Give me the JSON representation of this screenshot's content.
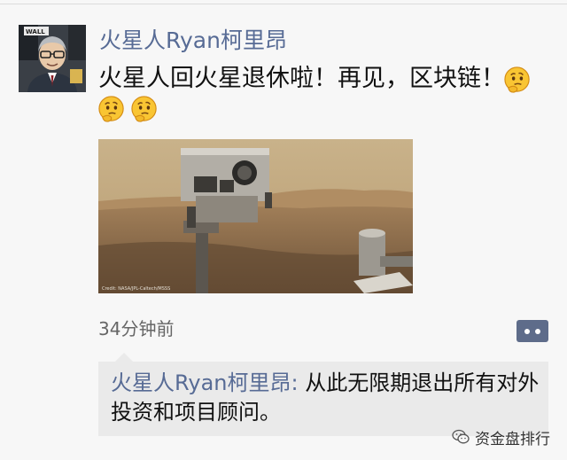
{
  "post": {
    "user_name": "火星人Ryan柯里昂",
    "text": "火星人回火星退休啦！再见，区块链！",
    "emojis": [
      "thinking-face-emoji",
      "thinking-face-emoji",
      "thinking-face-emoji"
    ],
    "photo_icon": "mars-rover-selfie",
    "photo_caption": "Credit: NASA/JPL-Caltech/MSSS",
    "timestamp": "34分钟前"
  },
  "comment": {
    "author": "火星人Ryan柯里昂:",
    "text": " 从此无限期退出所有对外投资和项目顾问。"
  },
  "avatar_label": "WALL",
  "watermark": {
    "icon": "wechat-icon",
    "text": "资金盘排行"
  },
  "colors": {
    "link": "#576b95",
    "more_button": "#5e6c8a",
    "comment_bg": "#eaeaea",
    "background": "#f7f7f7"
  }
}
